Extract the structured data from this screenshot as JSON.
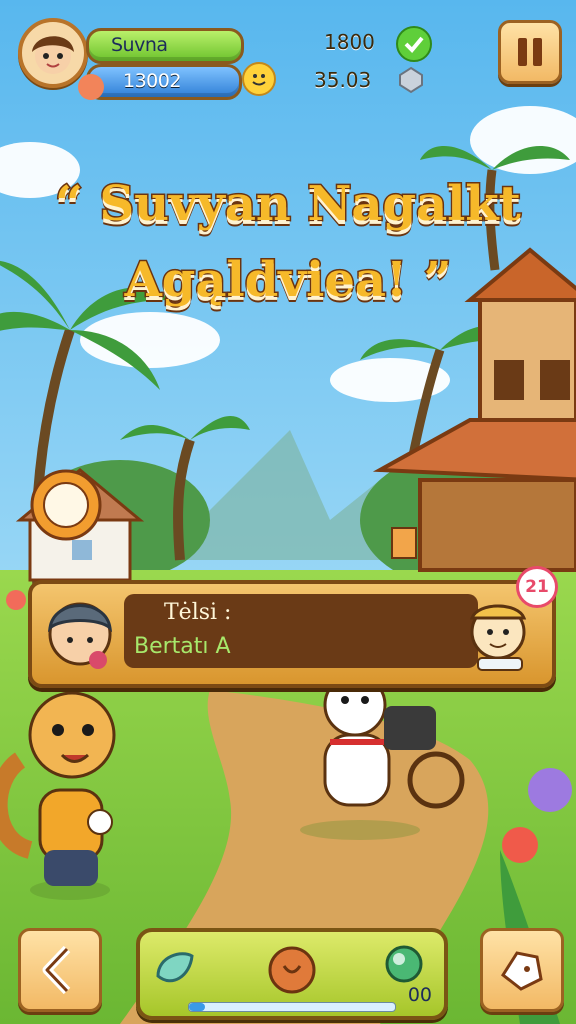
{
  "hud": {
    "player_name": "Suvna",
    "score": "13002",
    "top_value": "1800",
    "secondary_value": "35.03"
  },
  "title": {
    "line1": "“ Suvyan Nagalkt",
    "line2": "Agąldviea! ”"
  },
  "dialog": {
    "speaker": "Tėlsi :",
    "line": "Bertatı A",
    "badge": "21"
  },
  "bottom_bar": {
    "count": "00",
    "progress": 0.08
  },
  "colors": {
    "sky": "#7ec8f0",
    "grass": "#8fd24a",
    "path": "#d7a45a",
    "title_fill": "#f6b92a",
    "title_stroke": "#6b3410",
    "panel": "#f2b965"
  },
  "icons": [
    "avatar",
    "check-icon",
    "smiley-icon",
    "gem-icon",
    "pause-icon",
    "back-arrow-icon",
    "leaf-icon",
    "acorn-icon",
    "orb-icon",
    "map-icon"
  ]
}
